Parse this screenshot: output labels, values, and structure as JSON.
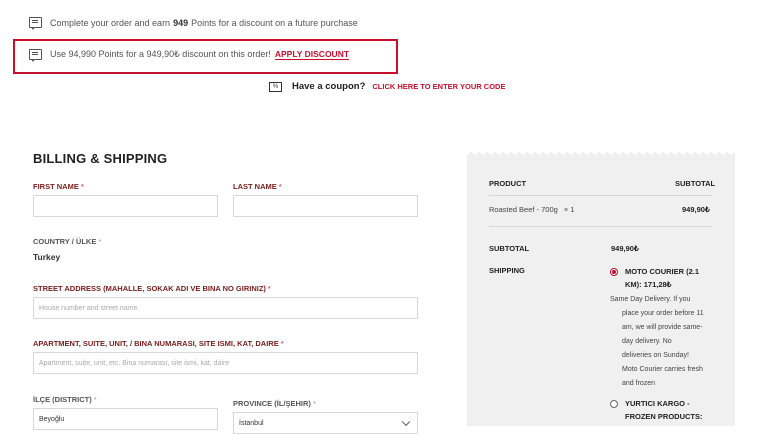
{
  "notices": {
    "earn_prefix": "Complete your order and earn ",
    "earn_points": "949",
    "earn_suffix": " Points for a discount on a future purchase",
    "redeem_text": "Use 94,990 Points for a 949,90₺ discount on this order!",
    "apply_label": "APPLY DISCOUNT"
  },
  "coupon": {
    "question": "Have a coupon?",
    "link": "CLICK HERE TO ENTER YOUR CODE"
  },
  "billing": {
    "title": "BILLING & SHIPPING",
    "first_name_label": "FIRST NAME",
    "last_name_label": "LAST NAME",
    "required_mark": "*",
    "country_label": "COUNTRY / ÜLKE",
    "country_value": "Turkey",
    "street_label": "STREET ADDRESS (MAHALLE, SOKAK ADI VE BINA NO GIRINIZ)",
    "street_placeholder": "House number and street name",
    "apartment_label": "APARTMENT, SUITE, UNIT, / BINA NUMARASI, SITE ISMI, KAT, DAIRE",
    "apartment_placeholder": "Apartment, suite, unit, etc. Bina numarası, site ismi, kat, daire",
    "district_label": "İLÇE (DISTRICT)",
    "district_value": "Beyoğlu",
    "province_label": "PROVINCE (İL/ŞEHIR)",
    "province_value": "İstanbul"
  },
  "summary": {
    "product_header": "PRODUCT",
    "subtotal_header": "SUBTOTAL",
    "item_name": "Roasted Beef - 700g",
    "item_qty": "× 1",
    "item_total": "949,90₺",
    "subtotal_label": "SUBTOTAL",
    "subtotal_value": "949,90₺",
    "shipping_label": "SHIPPING",
    "option1_line1": "MOTO COURIER (2.1",
    "option1_line2": "KM): 171,28₺",
    "option1_desc": [
      "Same Day Delivery. If you",
      "place your order before 11",
      "am, we will provide same-",
      "day delivery. No",
      "deliveries on Sunday!",
      "Moto Courier carries fresh",
      "and frozen"
    ],
    "option2_line1": "YURTICI KARGO -",
    "option2_line2": "FROZEN PRODUCTS:"
  },
  "colors": {
    "accent": "#c8102e",
    "summary_bg": "#f0f0f0"
  }
}
